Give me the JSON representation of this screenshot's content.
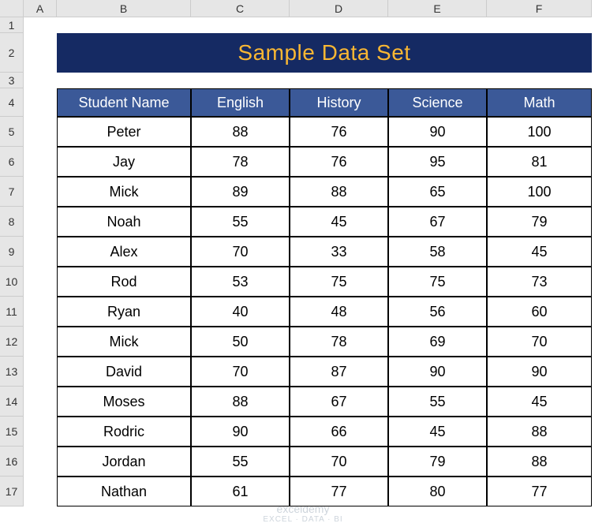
{
  "columns": [
    "A",
    "B",
    "C",
    "D",
    "E",
    "F"
  ],
  "rowCount": 17,
  "title": "Sample Data Set",
  "headers": [
    "Student Name",
    "English",
    "History",
    "Science",
    "Math"
  ],
  "chart_data": {
    "type": "table",
    "title": "Sample Data Set",
    "columns": [
      "Student Name",
      "English",
      "History",
      "Science",
      "Math"
    ],
    "rows": [
      [
        "Peter",
        88,
        76,
        90,
        100
      ],
      [
        "Jay",
        78,
        76,
        95,
        81
      ],
      [
        "Mick",
        89,
        88,
        65,
        100
      ],
      [
        "Noah",
        55,
        45,
        67,
        79
      ],
      [
        "Alex",
        70,
        33,
        58,
        45
      ],
      [
        "Rod",
        53,
        75,
        75,
        73
      ],
      [
        "Ryan",
        40,
        48,
        56,
        60
      ],
      [
        "Mick",
        50,
        78,
        69,
        70
      ],
      [
        "David",
        70,
        87,
        90,
        90
      ],
      [
        "Moses",
        88,
        67,
        55,
        45
      ],
      [
        "Rodric",
        90,
        66,
        45,
        88
      ],
      [
        "Jordan",
        55,
        70,
        79,
        88
      ],
      [
        "Nathan",
        61,
        77,
        80,
        77
      ]
    ]
  },
  "watermark": {
    "brand": "exceldemy",
    "tag": "EXCEL · DATA · BI"
  }
}
